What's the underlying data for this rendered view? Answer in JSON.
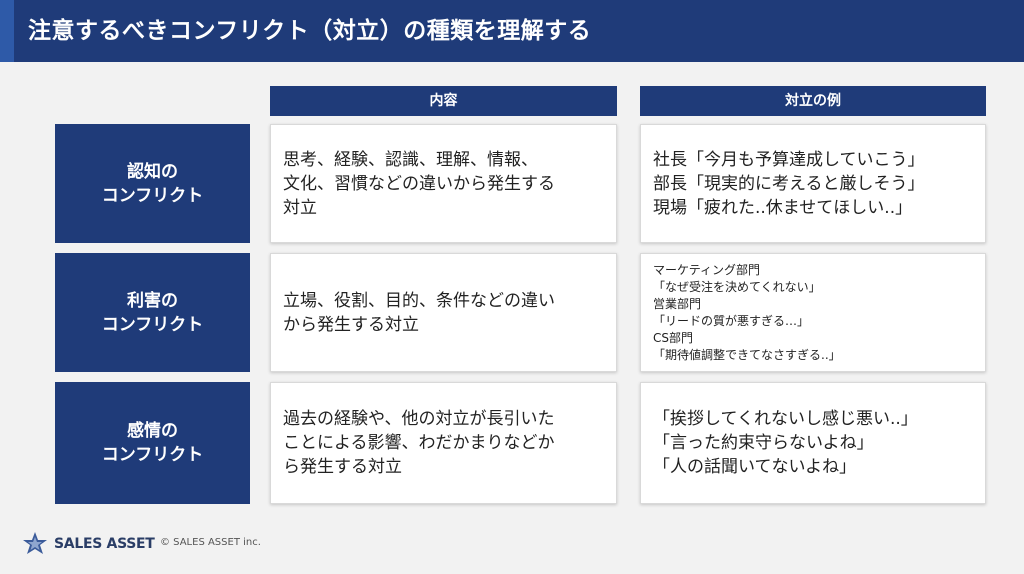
{
  "title": "注意するべきコンフリクト（対立）の種類を理解する",
  "columns": {
    "content": "内容",
    "example": "対立の例"
  },
  "rows": [
    {
      "label": "認知の\nコンフリクト",
      "content": "思考、経験、認識、理解、情報、\n文化、習慣などの違いから発生する\n対立",
      "example": "社長「今月も予算達成していこう」\n部長「現実的に考えると厳しそう」\n現場「疲れた..休ませてほしい..」"
    },
    {
      "label": "利害の\nコンフリクト",
      "content": "立場、役割、目的、条件などの違い\nから発生する対立",
      "example": "マーケティング部門\n「なぜ受注を決めてくれない」\n営業部門\n「リードの質が悪すぎる…」\nCS部門\n「期待値調整できてなさすぎる..」"
    },
    {
      "label": "感情の\nコンフリクト",
      "content": "過去の経験や、他の対立が長引いた\nことによる影響、わだかまりなどか\nら発生する対立",
      "example": "「挨拶してくれないし感じ悪い..」\n「言った約束守らないよね」\n「人の話聞いてないよね」"
    }
  ],
  "footer": {
    "logo": "SALES ASSET",
    "copyright": "© SALES ASSET inc."
  },
  "colors": {
    "navy": "#1f3b79",
    "accent": "#2e5aa8",
    "background": "#f2f2f2"
  }
}
